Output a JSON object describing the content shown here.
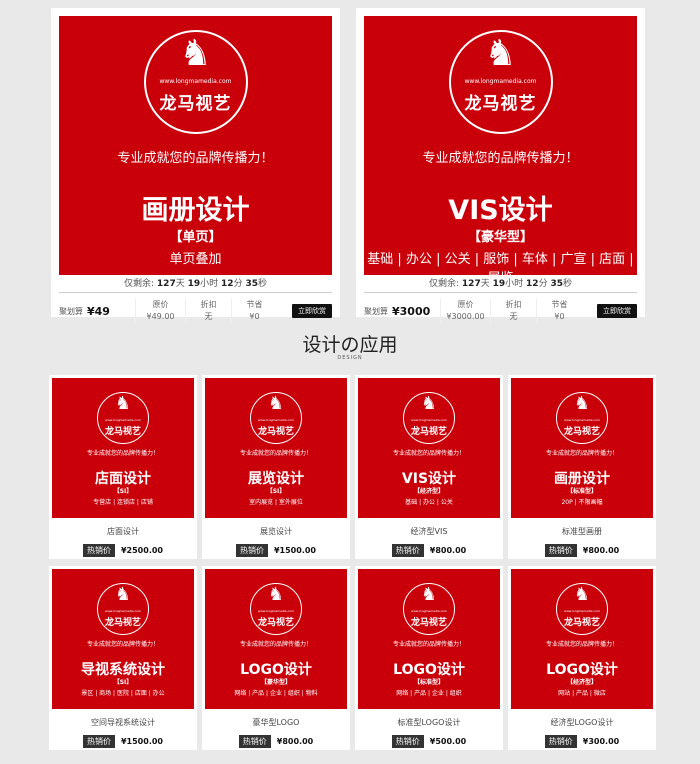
{
  "logo": {
    "url_text": "www.longmamedia.com",
    "name": "龙马视艺",
    "horse_glyph": "horse-icon"
  },
  "top_cards": [
    {
      "slogan": "专业成就您的品牌传播力！",
      "title": "画册设计",
      "subtitle": "【单页】",
      "desc": "单页叠加",
      "countdown_prefix": "仅剩余:",
      "days": "127",
      "hours": "19",
      "minutes": "12",
      "seconds": "35",
      "countdown_units": {
        "d": "天",
        "h": "小时",
        "m": "分",
        "s": "秒"
      },
      "price_label": "聚划算",
      "price": "¥49",
      "orig_label": "原价",
      "orig_value": "¥49.00",
      "disc_label": "折扣",
      "disc_value": "无",
      "save_label": "节省",
      "save_value": "¥0",
      "buy_label": "立即欣赏"
    },
    {
      "slogan": "专业成就您的品牌传播力！",
      "title": "VIS设计",
      "subtitle": "【豪华型】",
      "desc": "基础 | 办公 | 公关 | 服饰 | 车体 | 广宣 | 店面 | 展览",
      "countdown_prefix": "仅剩余:",
      "days": "127",
      "hours": "19",
      "minutes": "12",
      "seconds": "35",
      "countdown_units": {
        "d": "天",
        "h": "小时",
        "m": "分",
        "s": "秒"
      },
      "price_label": "聚划算",
      "price": "¥3000",
      "orig_label": "原价",
      "orig_value": "¥3000.00",
      "disc_label": "折扣",
      "disc_value": "无",
      "save_label": "节省",
      "save_value": "¥0",
      "buy_label": "立即欣赏"
    }
  ],
  "section": {
    "title": "设计の应用",
    "subtitle": "DESIGN"
  },
  "hot_label": "热销价",
  "small_cards": [
    {
      "slogan": "专业成就您的品牌传播力！",
      "title": "店面设计",
      "sub": "【SI】",
      "desc": "专营店 | 连锁店 | 店铺",
      "name": "店面设计",
      "price": "¥2500.00"
    },
    {
      "slogan": "专业成就您的品牌传播力！",
      "title": "展览设计",
      "sub": "【SI】",
      "desc": "室内展览 | 室外展位",
      "name": "展览设计",
      "price": "¥1500.00"
    },
    {
      "slogan": "专业成就您的品牌传播力！",
      "title": "VIS设计",
      "sub": "【经济型】",
      "desc": "基础 | 办公 | 公关",
      "name": "经济型VIS",
      "price": "¥800.00"
    },
    {
      "slogan": "专业成就您的品牌传播力！",
      "title": "画册设计",
      "sub": "【标准型】",
      "desc": "20P | 不限画幅",
      "name": "标准型画册",
      "price": "¥800.00"
    },
    {
      "slogan": "专业成就您的品牌传播力！",
      "title": "导视系统设计",
      "sub": "【SI】",
      "desc": "景区 | 商场 | 医院 | 店面 | 办公",
      "name": "空间导视系统设计",
      "price": "¥1500.00"
    },
    {
      "slogan": "专业成就您的品牌传播力！",
      "title": "LOGO设计",
      "sub": "【豪华型】",
      "desc": "网络 | 产品 | 企业 | 组织 | 物料",
      "name": "豪华型LOGO",
      "price": "¥800.00"
    },
    {
      "slogan": "专业成就您的品牌传播力！",
      "title": "LOGO设计",
      "sub": "【标准型】",
      "desc": "网络 | 产品 | 企业 | 组织",
      "name": "标准型LOGO设计",
      "price": "¥500.00"
    },
    {
      "slogan": "专业成就您的品牌传播力！",
      "title": "LOGO设计",
      "sub": "【经济型】",
      "desc": "网站 | 产品 | 微店",
      "name": "经济型LOGO设计",
      "price": "¥300.00"
    }
  ]
}
